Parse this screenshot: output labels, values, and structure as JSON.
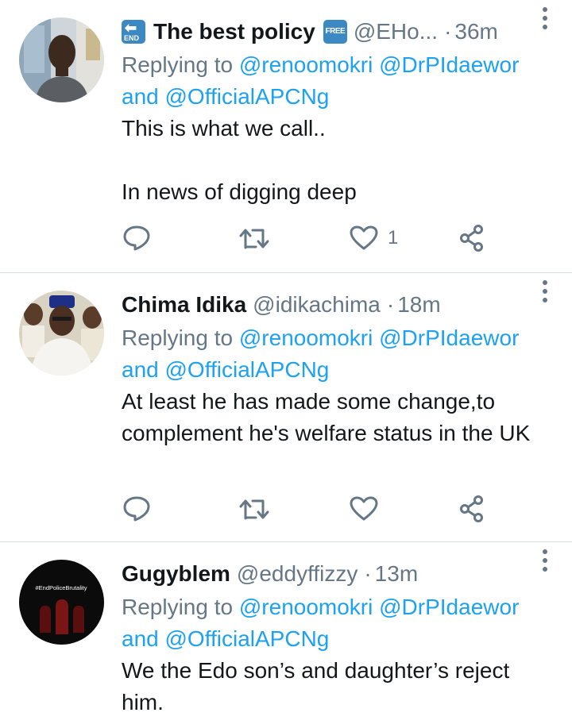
{
  "tweets": [
    {
      "display_name": "The best policy",
      "handle": "@EHo...",
      "time": "36m",
      "separator": "·",
      "badge_left": {
        "arrow": "⬅",
        "label": "END"
      },
      "badge_right": "FREE",
      "replying_prefix": "Replying to",
      "replying_users": "@renoomokri @DrPIdaewor",
      "replying_and": "and",
      "replying_last": "@OfficialAPCNg",
      "text": "This is what we call..\n\nIn news of digging deep",
      "like_count": "1"
    },
    {
      "display_name": "Chima Idika",
      "handle": "@idikachima",
      "time": "18m",
      "separator": "·",
      "replying_prefix": "Replying to",
      "replying_users": "@renoomokri @DrPIdaewor",
      "replying_and": "and",
      "replying_last": "@OfficialAPCNg",
      "text": "At least he has made some change,to complement he's welfare status in the UK",
      "like_count": ""
    },
    {
      "display_name": "Gugyblem",
      "handle": "@eddyffizzy",
      "time": "13m",
      "separator": "·",
      "avatar_text": "#EndPoliceBrutality",
      "replying_prefix": "Replying to",
      "replying_users": "@renoomokri @DrPIdaewor",
      "replying_and": "and",
      "replying_last": "@OfficialAPCNg",
      "text": "We the Edo son’s and daughter’s reject him."
    }
  ],
  "icons": {
    "reply": "reply-icon",
    "retweet": "retweet-icon",
    "like": "heart-icon",
    "share": "share-icon",
    "more": "more-vertical-icon"
  },
  "colors": {
    "link": "#1da1f2",
    "secondary_text": "#657786",
    "primary_text": "#14171a",
    "divider": "#d6dce0",
    "badge": "#3b88c3"
  }
}
